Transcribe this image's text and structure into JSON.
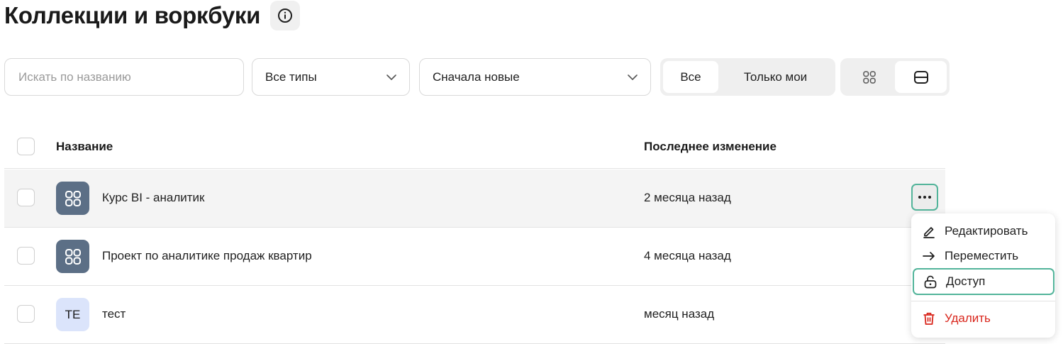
{
  "page": {
    "title": "Коллекции и воркбуки"
  },
  "toolbar": {
    "search_placeholder": "Искать по названию",
    "type_filter": "Все типы",
    "sort": "Сначала новые",
    "owner_filter": [
      "Все",
      "Только мои"
    ],
    "view_modes": [
      "grid-icon",
      "list-icon"
    ]
  },
  "table": {
    "headers": {
      "name": "Название",
      "changed": "Последнее изменение"
    },
    "rows": [
      {
        "icon": "collection-icon",
        "name": "Курс BI - аналитик",
        "changed": "2 месяца назад"
      },
      {
        "icon": "collection-icon",
        "name": "Проект по аналитике продаж квартир",
        "changed": "4 месяца назад"
      },
      {
        "initials": "ТЕ",
        "name": "тест",
        "changed": "месяц назад"
      }
    ]
  },
  "context_menu": {
    "items": [
      {
        "icon": "pencil-icon",
        "label": "Редактировать"
      },
      {
        "icon": "arrow-right-icon",
        "label": "Переместить"
      },
      {
        "icon": "lock-icon",
        "label": "Доступ"
      },
      {
        "icon": "trash-icon",
        "label": "Удалить"
      }
    ]
  },
  "colors": {
    "focus_ring": "#52b49a",
    "danger": "#d9261c",
    "collection_icon_bg": "#5c6f86",
    "initials_bg": "#dbe4fb"
  }
}
